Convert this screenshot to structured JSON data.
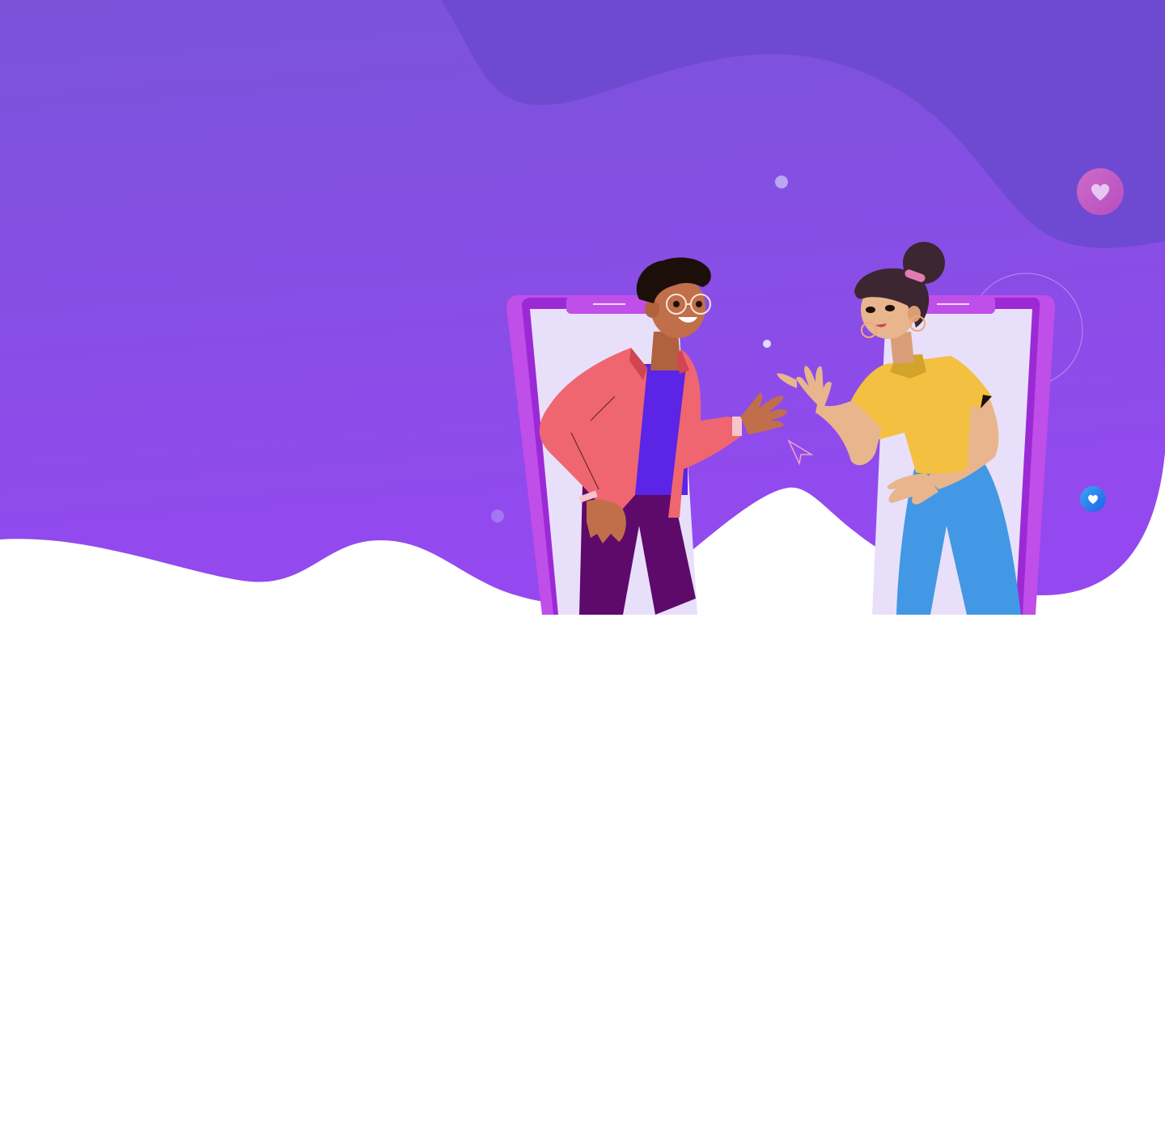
{
  "colors": {
    "background": "#ffffff",
    "hero_gradient_top": "#7a53d9",
    "hero_gradient_bottom": "#9449f0",
    "hero_dark_blob": "#6b49cf",
    "phone_frame": "#c04ee8",
    "phone_frame_inner": "#9b2ad6",
    "phone_screen": "#e8e0fa",
    "man_jacket": "#ef6670",
    "man_shirt": "#5b24e6",
    "man_pants": "#5e0a6b",
    "man_skin": "#c06f4a",
    "man_hair": "#1c0f0a",
    "woman_shirt": "#f3c042",
    "woman_collar": "#d4a32a",
    "woman_pants": "#4298e4",
    "woman_skin": "#e8b58c",
    "woman_hair": "#3b2631",
    "heart_badge_pink": "#c45ac4",
    "heart_badge_blue": "#2a78ee"
  },
  "icons": {
    "heart_badge_top": "heart-icon",
    "heart_badge_bottom": "heart-icon",
    "cursor": "paper-plane-cursor-icon"
  }
}
